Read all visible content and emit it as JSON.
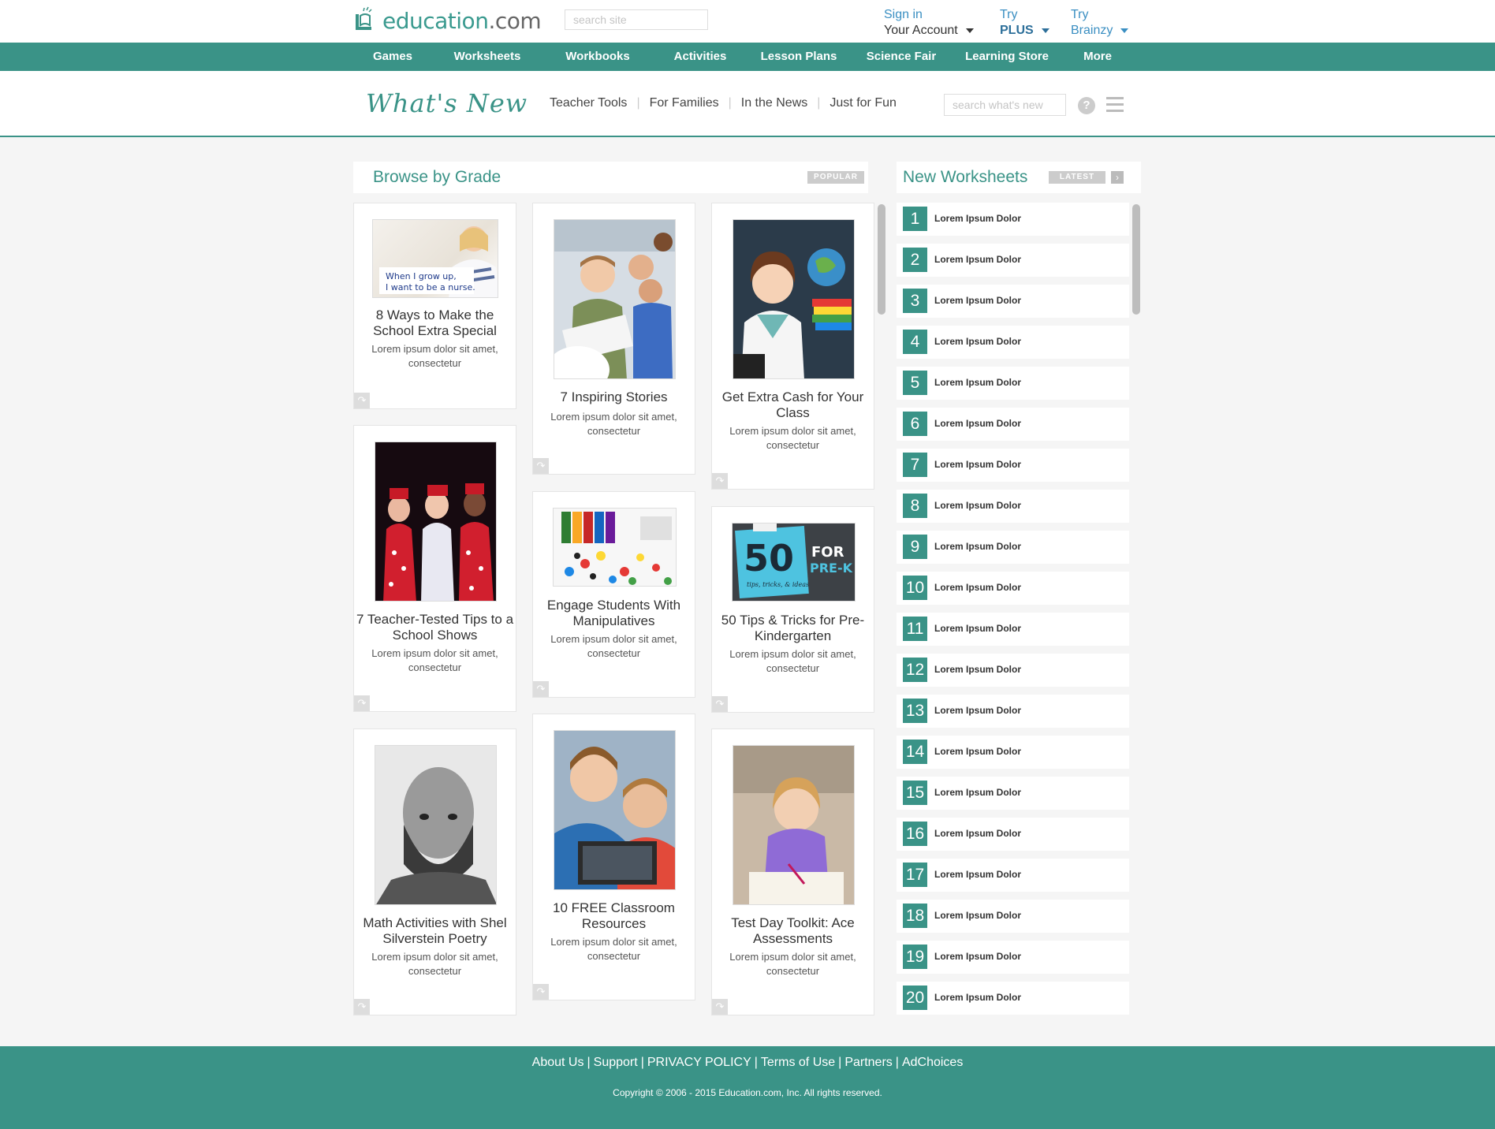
{
  "header": {
    "logo_text": "education",
    "logo_suffix": ".com",
    "search_placeholder": "search site",
    "account": {
      "line1": "Sign in",
      "line2": "Your Account"
    },
    "plus": {
      "line1": "Try",
      "line2": "PLUS"
    },
    "brainzy": {
      "line1": "Try",
      "line2": "Brainzy"
    }
  },
  "nav": [
    "Games",
    "Worksheets",
    "Workbooks",
    "Activities",
    "Lesson Plans",
    "Science Fair",
    "Learning Store",
    "More"
  ],
  "subheader": {
    "title": "What's New",
    "links": [
      "Teacher Tools",
      "For Families",
      "In the News",
      "Just for Fun"
    ],
    "search_placeholder": "search what's new"
  },
  "browse": {
    "title": "Browse by Grade",
    "tag": "POPULAR",
    "cards": [
      {
        "title": "8 Ways to Make the School Extra Special",
        "desc": "Lorem ipsum dolor sit amet, consectetur",
        "img_caption": "When I grow up, I want to be a nurse."
      },
      {
        "title": "7 Inspiring Stories",
        "desc": "Lorem ipsum dolor sit amet, consectetur"
      },
      {
        "title": "Get Extra Cash for Your Class",
        "desc": "Lorem ipsum dolor sit amet, consectetur"
      },
      {
        "title": "7 Teacher-Tested Tips to a School Shows",
        "desc": "Lorem ipsum dolor sit amet, consectetur"
      },
      {
        "title": "Engage Students With Manipulatives",
        "desc": "Lorem ipsum dolor sit amet, consectetur"
      },
      {
        "title": "50 Tips & Tricks for Pre-Kindergarten",
        "desc": "Lorem ipsum dolor sit amet, consectetur",
        "img_big": "50",
        "img_for": "FOR",
        "img_prek": "PRE-K",
        "img_small": "tips, tricks, & ideas"
      },
      {
        "title": "Math Activities with Shel Silverstein Poetry",
        "desc": "Lorem ipsum dolor sit amet, consectetur"
      },
      {
        "title": "10 FREE Classroom Resources",
        "desc": "Lorem ipsum dolor sit amet, consectetur"
      },
      {
        "title": "Test Day Toolkit: Ace Assessments",
        "desc": "Lorem ipsum dolor sit amet, consectetur"
      }
    ]
  },
  "worksheets": {
    "title": "New Worksheets",
    "tag": "LATEST",
    "items": [
      {
        "num": "1",
        "label": "Lorem Ipsum Dolor"
      },
      {
        "num": "2",
        "label": "Lorem Ipsum Dolor"
      },
      {
        "num": "3",
        "label": "Lorem Ipsum Dolor"
      },
      {
        "num": "4",
        "label": "Lorem Ipsum Dolor"
      },
      {
        "num": "5",
        "label": "Lorem Ipsum Dolor"
      },
      {
        "num": "6",
        "label": "Lorem Ipsum Dolor"
      },
      {
        "num": "7",
        "label": "Lorem Ipsum Dolor"
      },
      {
        "num": "8",
        "label": "Lorem Ipsum Dolor"
      },
      {
        "num": "9",
        "label": "Lorem Ipsum Dolor"
      },
      {
        "num": "10",
        "label": "Lorem Ipsum Dolor"
      },
      {
        "num": "11",
        "label": "Lorem Ipsum Dolor"
      },
      {
        "num": "12",
        "label": "Lorem Ipsum Dolor"
      },
      {
        "num": "13",
        "label": "Lorem Ipsum Dolor"
      },
      {
        "num": "14",
        "label": "Lorem Ipsum Dolor"
      },
      {
        "num": "15",
        "label": "Lorem Ipsum Dolor"
      },
      {
        "num": "16",
        "label": "Lorem Ipsum Dolor"
      },
      {
        "num": "17",
        "label": "Lorem Ipsum Dolor"
      },
      {
        "num": "18",
        "label": "Lorem Ipsum Dolor"
      },
      {
        "num": "19",
        "label": "Lorem Ipsum Dolor"
      },
      {
        "num": "20",
        "label": "Lorem Ipsum Dolor"
      }
    ]
  },
  "footer": {
    "links": [
      "About Us",
      "Support",
      "PRIVACY POLICY",
      "Terms of Use",
      "Partners",
      "AdChoices"
    ],
    "copyright": "Copyright © 2006 - 2015 Education.com, Inc. All rights reserved."
  },
  "colors": {
    "brand": "#3a9387",
    "link": "#3b8fc2"
  }
}
